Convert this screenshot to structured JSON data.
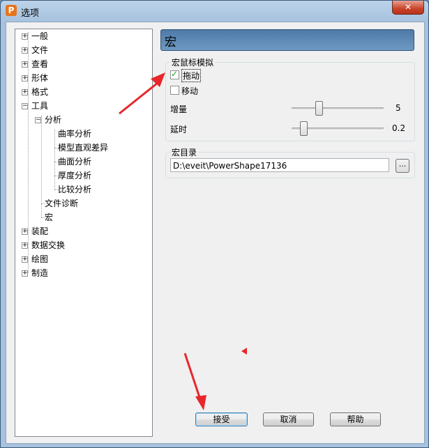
{
  "window": {
    "title": "选项",
    "app_icon_letter": "P",
    "close_glyph": "✕"
  },
  "tree": {
    "expand_glyph": "+",
    "collapse_glyph": "−",
    "items": [
      {
        "label": "一般",
        "state": "collapsed"
      },
      {
        "label": "文件",
        "state": "collapsed"
      },
      {
        "label": "查看",
        "state": "collapsed"
      },
      {
        "label": "形体",
        "state": "collapsed"
      },
      {
        "label": "格式",
        "state": "collapsed"
      },
      {
        "label": "工具",
        "state": "expanded"
      },
      {
        "label": "分析",
        "state": "expanded"
      },
      {
        "label": "曲率分析"
      },
      {
        "label": "模型直观差异"
      },
      {
        "label": "曲面分析"
      },
      {
        "label": "厚度分析"
      },
      {
        "label": "比较分析"
      },
      {
        "label": "文件诊断"
      },
      {
        "label": "宏"
      },
      {
        "label": "装配",
        "state": "collapsed"
      },
      {
        "label": "数据交换",
        "state": "collapsed"
      },
      {
        "label": "绘图",
        "state": "collapsed"
      },
      {
        "label": "制造",
        "state": "collapsed"
      }
    ]
  },
  "panel": {
    "header": "宏",
    "mouse_group": {
      "title": "宏鼠标模拟",
      "drag": {
        "label": "拖动",
        "checked": true
      },
      "move": {
        "label": "移动",
        "checked": false
      },
      "increment": {
        "label": "增量",
        "value": "5",
        "level_fraction": 0.28
      },
      "delay": {
        "label": "延时",
        "value": "0.2",
        "level_fraction": 0.1
      }
    },
    "dir_group": {
      "title": "宏目录",
      "path": "D:\\eveit\\PowerShape17136",
      "browse_label": "..."
    }
  },
  "buttons": {
    "accept": "接受",
    "cancel": "取消",
    "help": "帮助"
  },
  "colors": {
    "annotation_arrow": "#e8262b",
    "accent": "#3c7fb1"
  }
}
